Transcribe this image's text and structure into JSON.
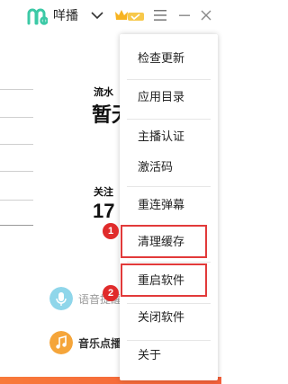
{
  "titlebar": {
    "app_name": "咩播",
    "colors": {
      "logo": "#3cc9a6",
      "badge": "#f7b321"
    }
  },
  "stats": {
    "flow_label": "流水",
    "flow_value": "暂无",
    "follow_label": "关注",
    "follow_value": "17"
  },
  "features": [
    {
      "label": "语音提醒",
      "icon": "microphone-icon",
      "color": "#8fd6ea"
    },
    {
      "label": "音乐点播",
      "icon": "music-note-icon",
      "color": "#f5a53a"
    }
  ],
  "menu": {
    "items": [
      {
        "label": "检查更新"
      },
      {
        "label": "应用目录"
      },
      {
        "label": "主播认证"
      },
      {
        "label": "激活码"
      },
      {
        "label": "重连弹幕"
      },
      {
        "label": "清理缓存"
      },
      {
        "label": "重启软件"
      },
      {
        "label": "关闭软件"
      },
      {
        "label": "关于"
      }
    ]
  },
  "annotations": [
    {
      "number": "1",
      "target": "清理缓存"
    },
    {
      "number": "2",
      "target": "重启软件"
    }
  ],
  "colors": {
    "highlight": "#e23a3a",
    "accent_strip": "#f4603a"
  }
}
